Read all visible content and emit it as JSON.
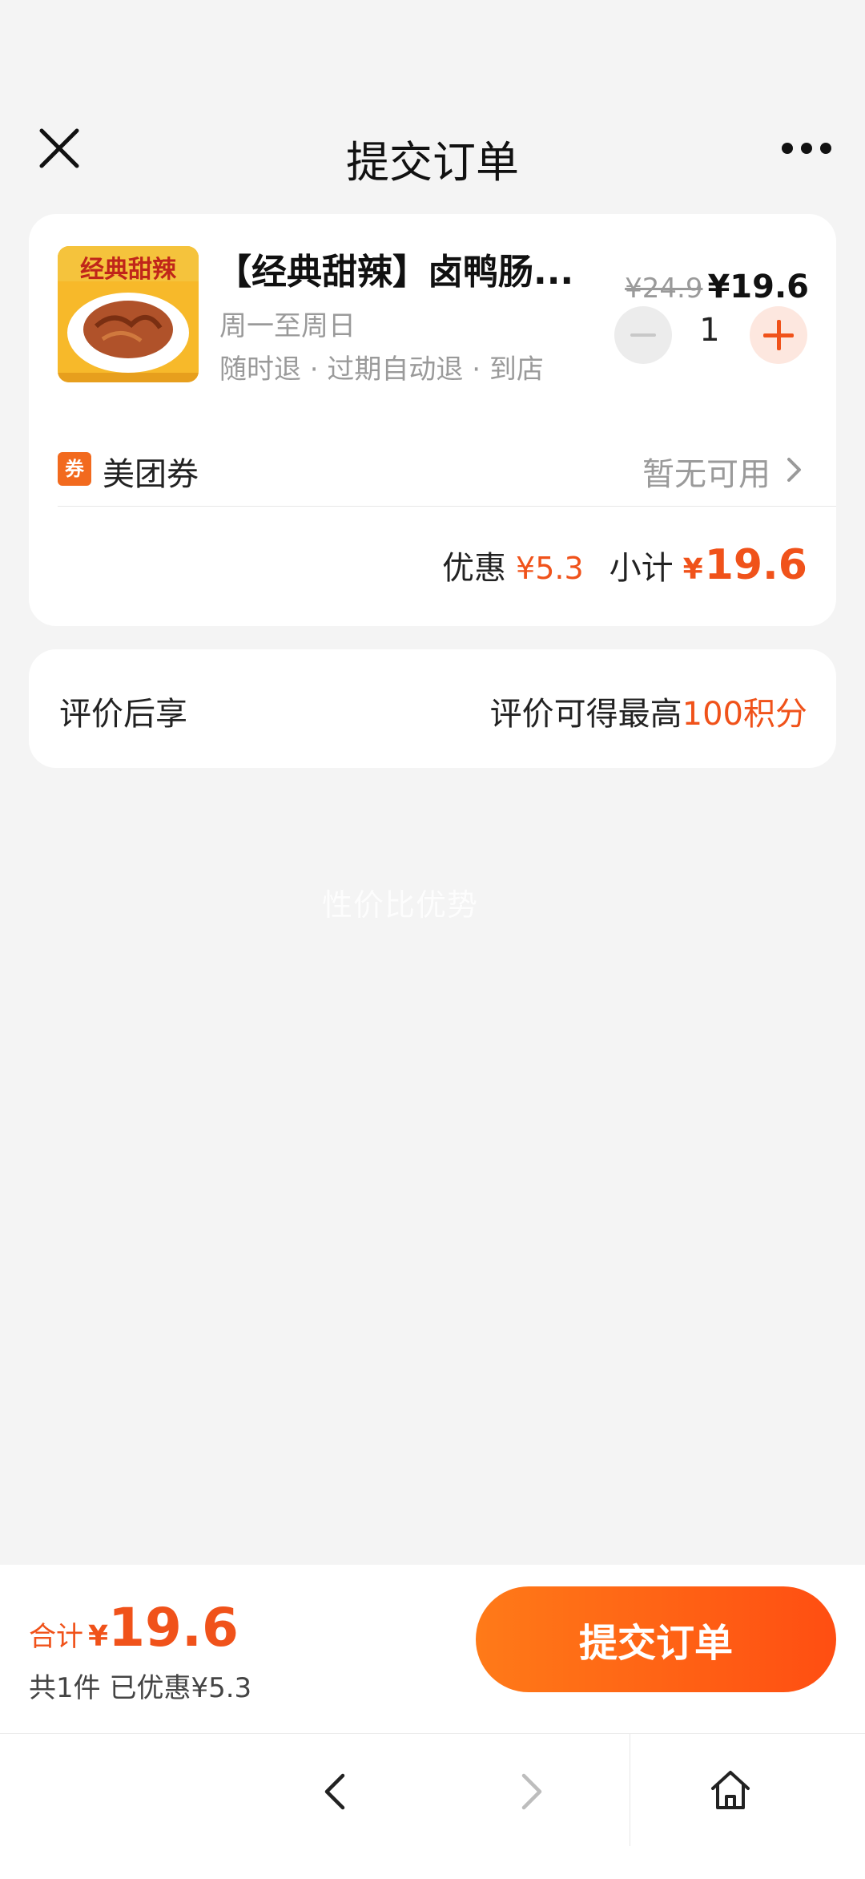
{
  "header": {
    "title": "提交订单",
    "close_icon": "close-icon",
    "more_icon": "more-icon"
  },
  "order": {
    "product_name": "【经典甜辣】卤鸭肠...",
    "product_image_text": "经典甜辣",
    "availability": "周一至周日",
    "refund_policy": "随时退 · 过期自动退 · 到店",
    "original_price": "¥24.9",
    "current_price": "¥19.6",
    "quantity": "1",
    "coupon": {
      "badge": "券",
      "label": "美团券",
      "value": "暂无可用"
    },
    "summary": {
      "discount_label": "优惠",
      "discount_value": "¥5.3",
      "subtotal_label": "小计",
      "subtotal_yen": "¥",
      "subtotal_value": "19.6"
    }
  },
  "review": {
    "label": "评价后享",
    "value_prefix": "评价可得最高",
    "value_accent": "100积分"
  },
  "watermark": "性价比优势",
  "footer": {
    "total_label": "合计",
    "total_yen": "¥",
    "total_amount": "19.6",
    "count_text": "共1件  已优惠¥5.3",
    "submit_label": "提交订单"
  },
  "navbar": {
    "back_icon": "chevron-left-icon",
    "forward_icon": "chevron-right-icon",
    "home_icon": "home-icon"
  },
  "colors": {
    "accent": "#f0521a",
    "button_gradient_start": "#ff7a18",
    "button_gradient_end": "#ff4e12",
    "background": "#f4f4f4"
  }
}
